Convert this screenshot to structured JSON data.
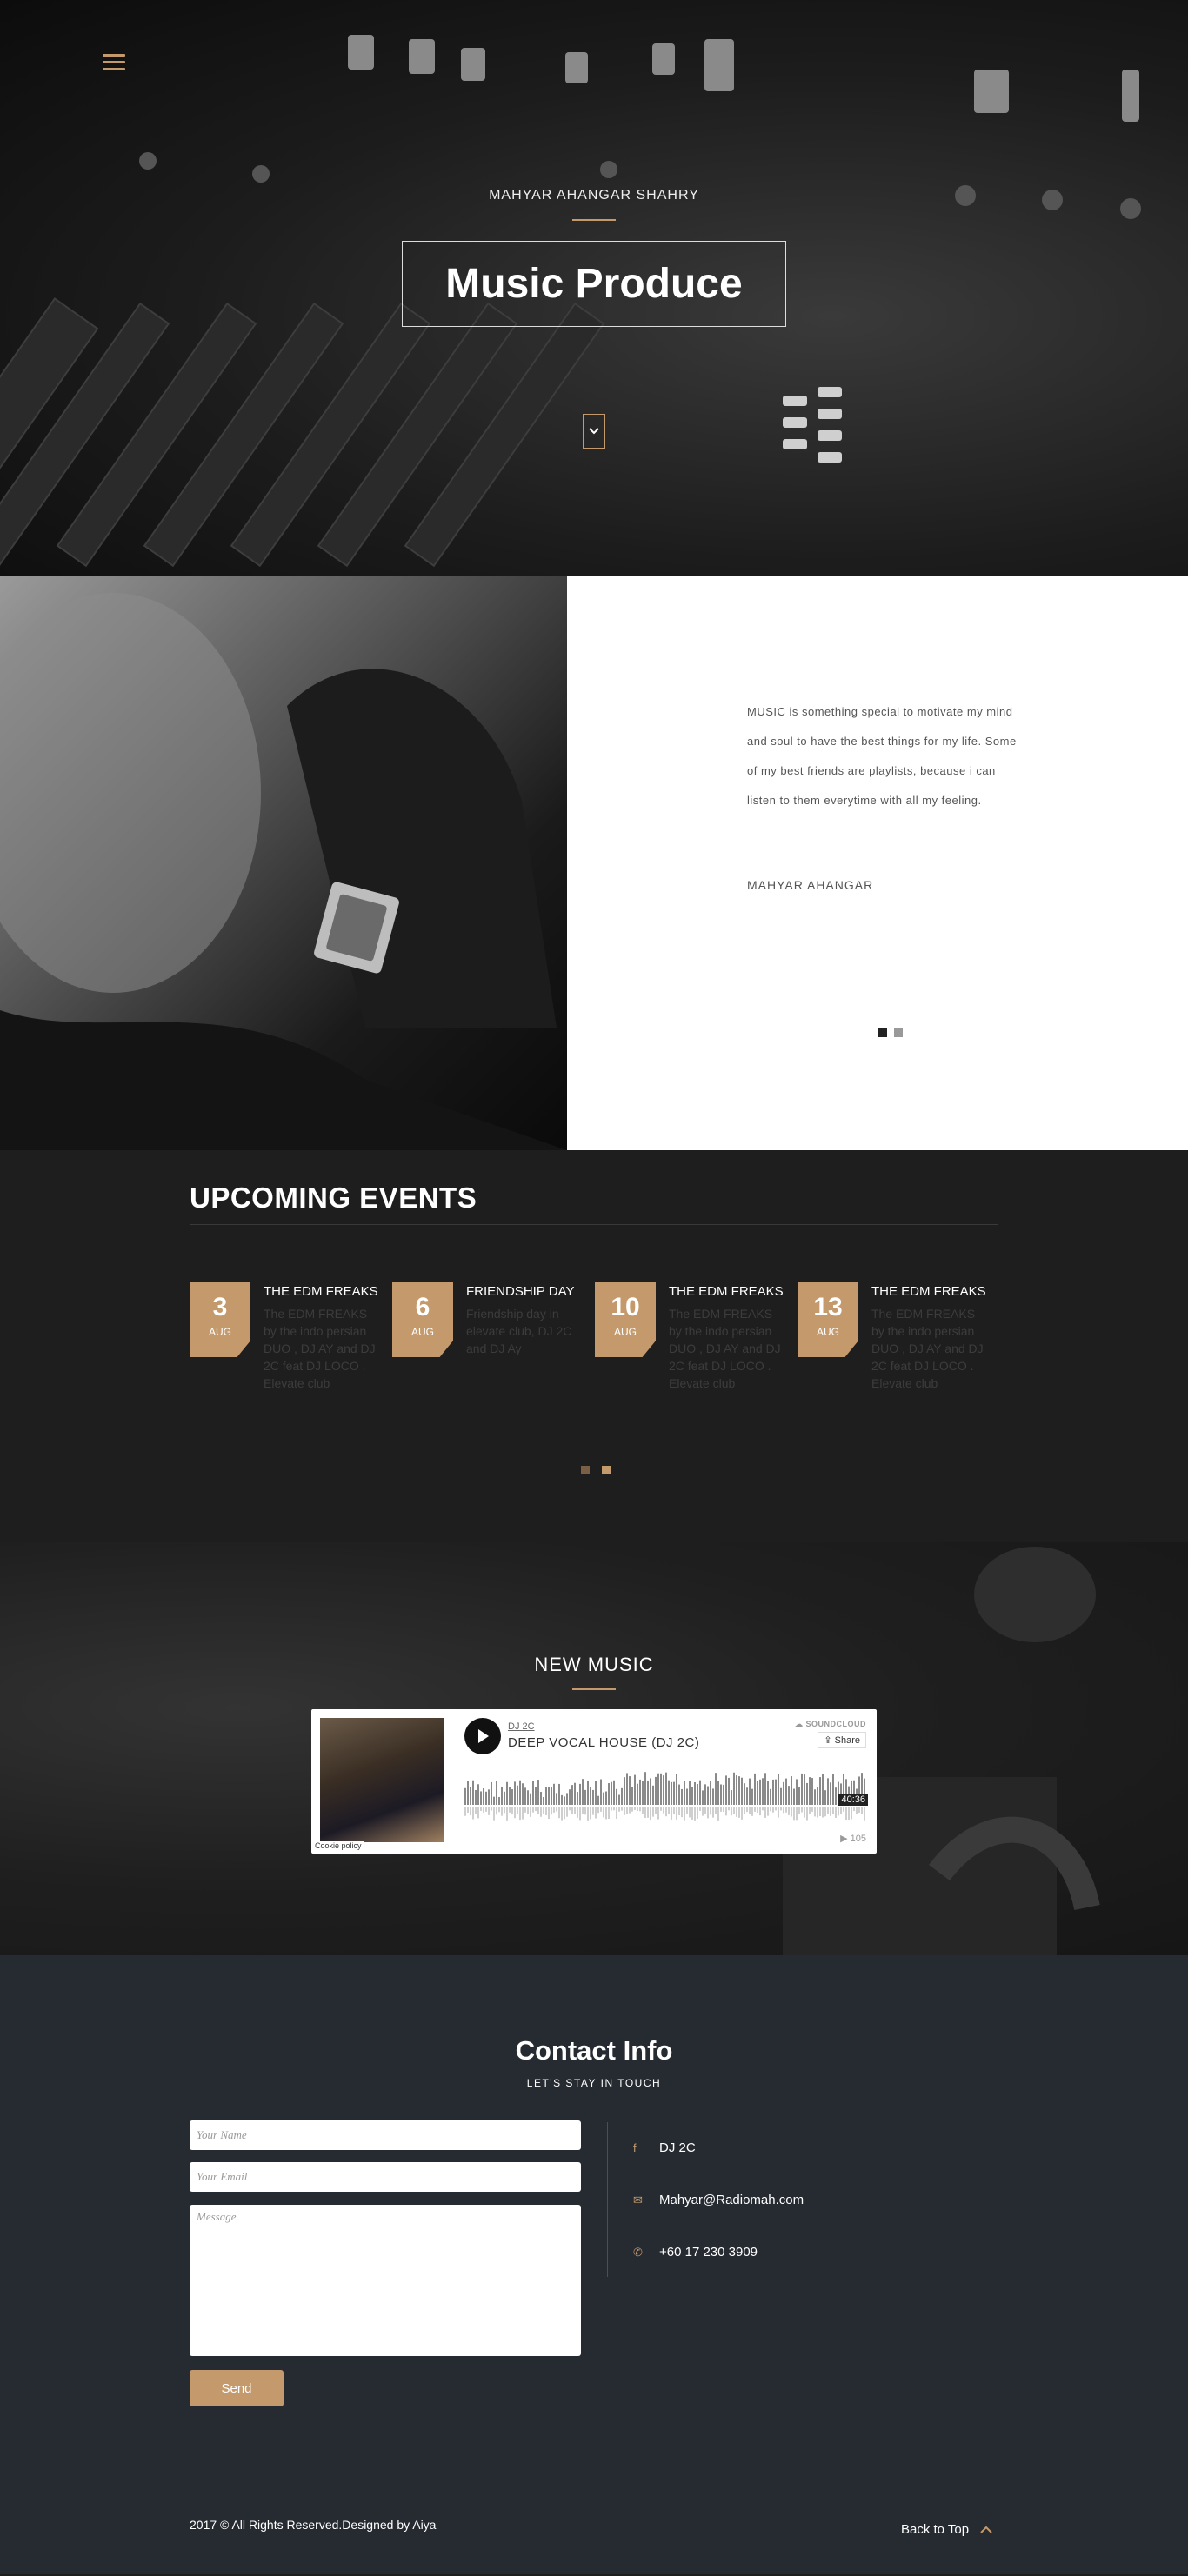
{
  "hero": {
    "subtitle": "MAHYAR AHANGAR SHAHRY",
    "title": "Music Produce"
  },
  "about": {
    "quote": "MUSIC is something special to motivate my mind and soul to have the best things for my life. Some of my best friends are playlists, because i can listen to them everytime with all my feeling.",
    "author": "MAHYAR AHANGAR"
  },
  "events": {
    "heading": "UPCOMING EVENTS",
    "items": [
      {
        "day": "3",
        "month": "AUG",
        "name": "THE EDM FREAKS",
        "desc": "The EDM FREAKS by the indo persian DUO , DJ AY and DJ 2C feat DJ LOCO . Elevate club"
      },
      {
        "day": "6",
        "month": "AUG",
        "name": "FRIENDSHIP DAY",
        "desc": "Friendship day in elevate club, DJ 2C and DJ Ay"
      },
      {
        "day": "10",
        "month": "AUG",
        "name": "THE EDM FREAKS",
        "desc": "The EDM FREAKS by the indo persian DUO , DJ AY and DJ 2C feat DJ LOCO . Elevate club"
      },
      {
        "day": "13",
        "month": "AUG",
        "name": "THE EDM FREAKS",
        "desc": "The EDM FREAKS by the indo persian DUO , DJ AY and DJ 2C feat DJ LOCO . Elevate club"
      }
    ]
  },
  "music": {
    "heading": "NEW MUSIC",
    "player": {
      "artist": "DJ 2C",
      "track": "DEEP VOCAL HOUSE (DJ 2C)",
      "brand": "SOUNDCLOUD",
      "share": "Share",
      "duration": "40:36",
      "plays": "105",
      "cookie": "Cookie policy"
    }
  },
  "contact": {
    "heading": "Contact Info",
    "tagline": "LET'S STAY IN TOUCH",
    "name_placeholder": "Your Name",
    "email_placeholder": "Your Email",
    "message_placeholder": "Message",
    "send_label": "Send",
    "info": {
      "name": "DJ 2C",
      "email": "Mahyar@Radiomah.com",
      "phone": "+60 17 230 3909"
    }
  },
  "footer": {
    "copyright": "2017 © All Rights Reserved.Designed by Aiya",
    "back_to_top": "Back to Top"
  },
  "colors": {
    "accent": "#c49a6c",
    "dark": "#1e1e1e",
    "contact_bg": "#262b32"
  }
}
